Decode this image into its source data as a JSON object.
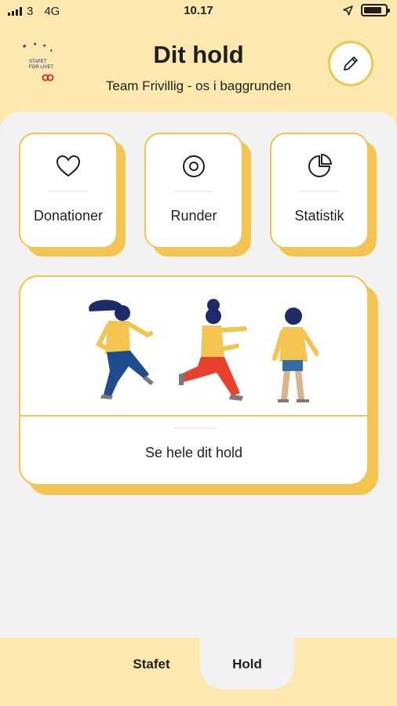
{
  "status_bar": {
    "carrier": "3",
    "network": "4G",
    "time": "10.17",
    "battery_level": 0.85
  },
  "header": {
    "logo_text": "STAFET FOR LIVET",
    "title": "Dit hold",
    "team_name": "Team Frivillig - os i baggrunden",
    "edit_icon": "pencil-icon"
  },
  "tiles": [
    {
      "label": "Donationer",
      "icon": "heart-icon"
    },
    {
      "label": "Runder",
      "icon": "target-icon"
    },
    {
      "label": "Statistik",
      "icon": "pie-chart-icon"
    }
  ],
  "team_card": {
    "link_label": "Se hele dit hold"
  },
  "tab_bar": {
    "tabs": [
      {
        "label": "Stafet",
        "active": false
      },
      {
        "label": "Hold",
        "active": true
      }
    ]
  },
  "colors": {
    "accent_yellow": "#f3c44f",
    "header_background": "#fde8b0",
    "content_background": "#f2f2f2",
    "logo_red": "#e2231a",
    "logo_navy": "#1f2a6b"
  }
}
